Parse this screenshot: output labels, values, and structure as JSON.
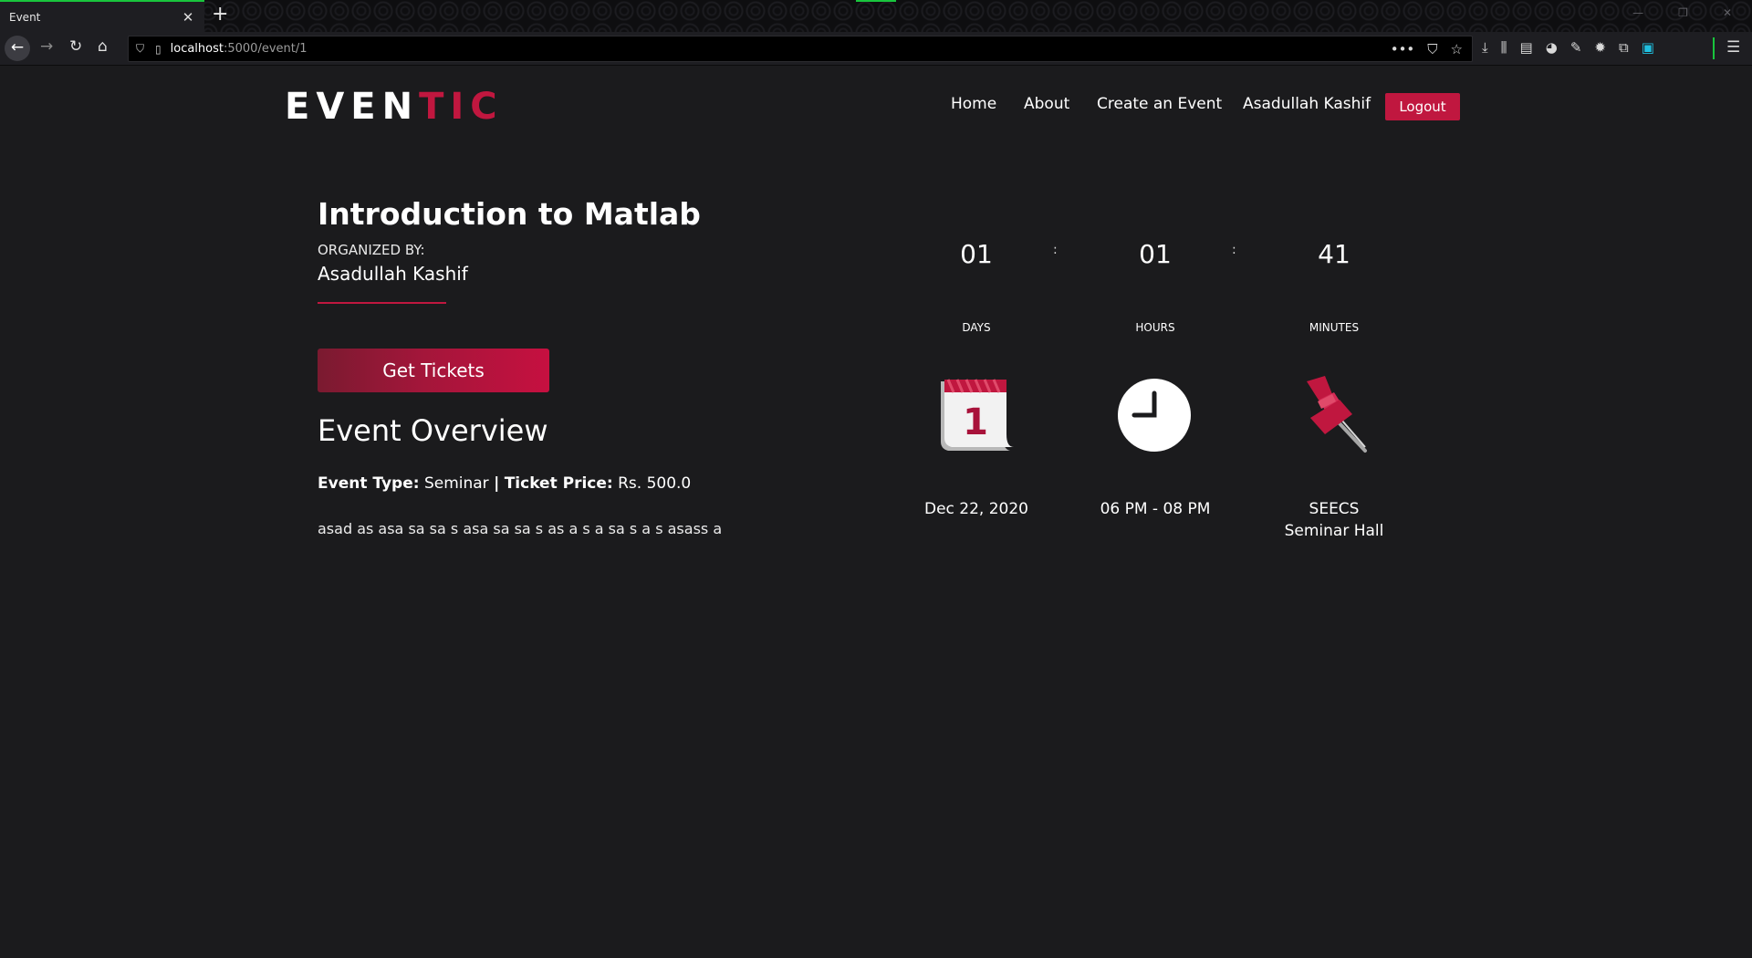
{
  "browser": {
    "tab_title": "Event",
    "tab_close": "✕",
    "new_tab": "+",
    "url_host": "localhost",
    "url_path": ":5000/event/1",
    "url_actions": [
      "•••",
      "⛉",
      "☆"
    ],
    "toolbar_icons": [
      "⤓",
      "⫼",
      "▤",
      "◕",
      "✎",
      "✹",
      "⧉",
      "▣"
    ],
    "menu_icon": "☰"
  },
  "site": {
    "logo_part1": "EVEN",
    "logo_part2": "TIC",
    "nav": {
      "home": "Home",
      "about": "About",
      "create": "Create an Event",
      "user": "Asadullah Kashif",
      "logout": "Logout"
    }
  },
  "event": {
    "title": "Introduction to Matlab",
    "organized_by_label": "ORGANIZED BY:",
    "organizer": "Asadullah Kashif",
    "tickets_button": "Get Tickets",
    "overview_heading": "Event Overview",
    "type_label": "Event Type:",
    "type_value": "Seminar",
    "separator": "|",
    "price_label": "Ticket Price:",
    "price_value": "Rs. 500.0",
    "description": "asad as asa sa sa s asa sa sa s as a s a sa s a s asass a"
  },
  "countdown": {
    "days": "01",
    "hours": "01",
    "minutes": "41",
    "days_label": "DAYS",
    "hours_label": "HOURS",
    "minutes_label": "MINUTES",
    "colon": ":"
  },
  "details": {
    "date": "Dec 22, 2020",
    "time": "06 PM - 08 PM",
    "venue": "SEECS Seminar Hall",
    "calendar_day": "1"
  },
  "colors": {
    "accent": "#c0173f",
    "background": "#1b1b1d"
  }
}
